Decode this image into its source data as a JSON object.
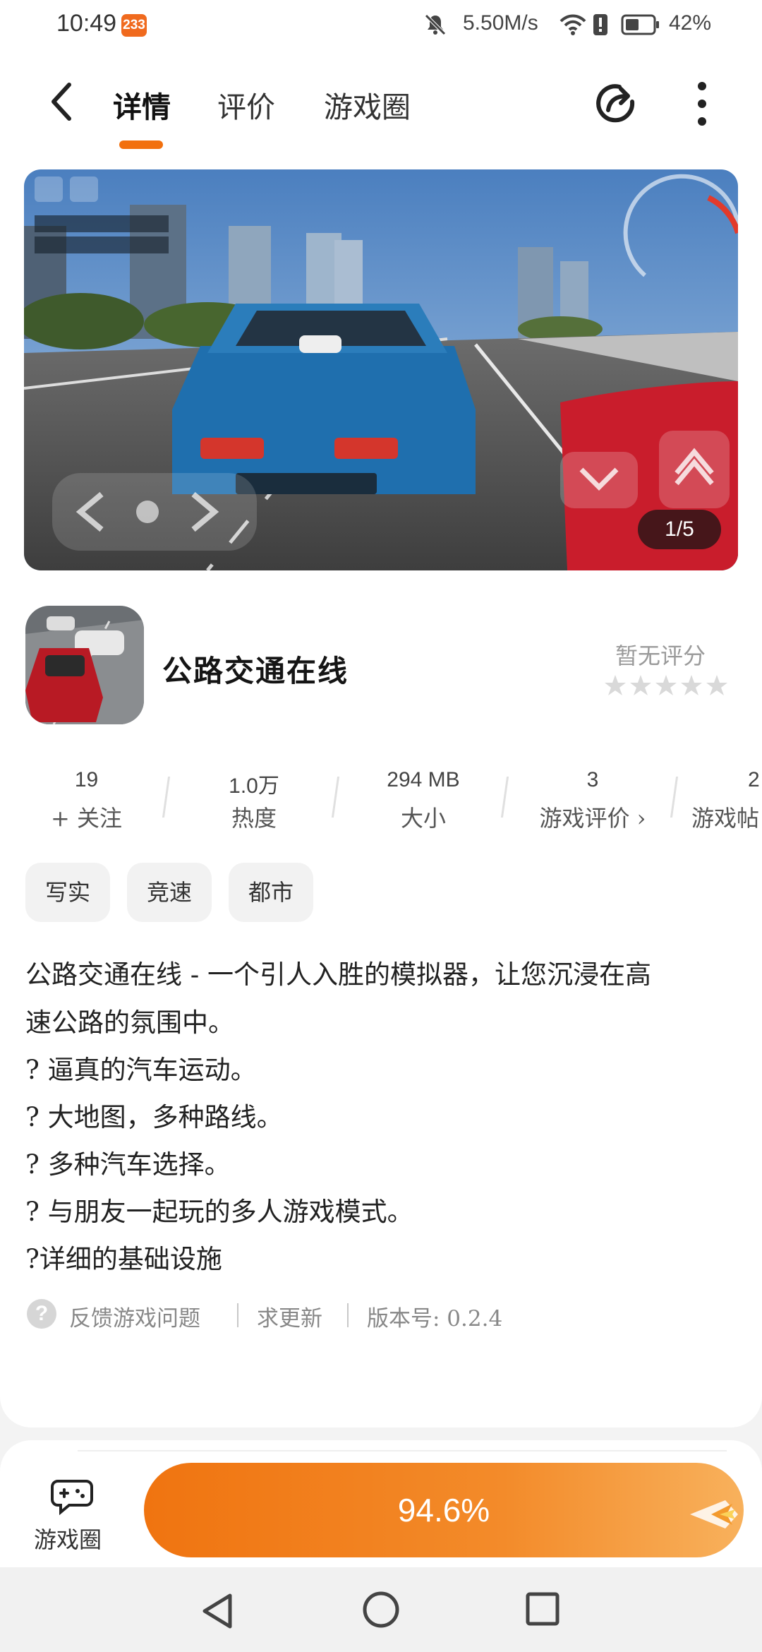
{
  "status_bar": {
    "time": "10:49",
    "badge": "233",
    "net_speed": "5.50M/s",
    "battery_percent": "42%",
    "icons": [
      "mute-icon",
      "wifi-icon",
      "alert-icon",
      "battery-icon"
    ]
  },
  "nav": {
    "tabs": [
      {
        "label": "详情",
        "active": true
      },
      {
        "label": "评价",
        "active": false
      },
      {
        "label": "游戏圈",
        "active": false
      }
    ],
    "icons": [
      "back-arrow-icon",
      "share-icon",
      "more-vertical-icon"
    ]
  },
  "gallery": {
    "counter": "1/5"
  },
  "app": {
    "name": "公路交通在线",
    "rating_text": "暂无评分",
    "stars_filled": 0,
    "stars_total": 5
  },
  "stats": [
    {
      "value": "19",
      "label": "+ 关注"
    },
    {
      "value": "1.0万",
      "label": "热度"
    },
    {
      "value": "294 MB",
      "label": "大小"
    },
    {
      "value": "3",
      "label": "游戏评价 ›"
    },
    {
      "value": "2",
      "label": "游戏帖"
    }
  ],
  "tags": [
    "写实",
    "竞速",
    "都市"
  ],
  "description": [
    "公路交通在线 - 一个引人入胜的模拟器，让您沉浸在高",
    "速公路的氛围中。",
    "? 逼真的汽车运动。",
    "? 大地图，多种路线。",
    "? 多种汽车选择。",
    "? 与朋友一起玩的多人游戏模式。",
    "?详细的基础设施"
  ],
  "footer": {
    "help_icon": "?",
    "feedback": "反馈游戏问题",
    "request_update": "求更新",
    "version": "版本号: 0.2.4"
  },
  "bottom": {
    "circle_label": "游戏圈",
    "download_progress_text": "94.6%",
    "download_progress": 0.946,
    "accent_color": "#f2700e"
  }
}
